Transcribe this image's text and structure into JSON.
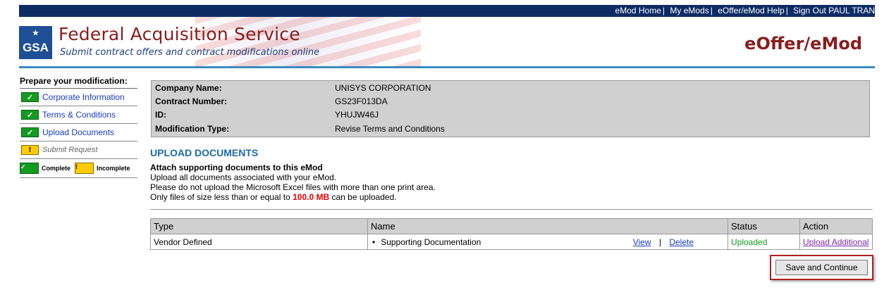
{
  "topnav": {
    "links": [
      "eMod Home",
      "My eMods",
      "eOffer/eMod Help",
      "Sign Out PAUL TRAN"
    ],
    "separator": "|"
  },
  "header": {
    "logo_text": "GSA",
    "logo_star": "★",
    "title": "Federal Acquisition Service",
    "subtitle": "Submit contract offers and contract modifications online",
    "app_title": "eOffer/eMod"
  },
  "sidebar": {
    "heading": "Prepare your modification:",
    "items": [
      {
        "label": "Corporate Information",
        "state": "complete"
      },
      {
        "label": "Terms & Conditions",
        "state": "complete"
      },
      {
        "label": "Upload Documents",
        "state": "complete"
      },
      {
        "label": "Submit Request",
        "state": "incomplete"
      }
    ],
    "legend": {
      "complete": "Complete",
      "incomplete": "Incomplete"
    },
    "check_icon": "✓",
    "warn_icon": "!"
  },
  "company": {
    "rows": [
      {
        "label": "Company Name:",
        "value": "UNISYS CORPORATION"
      },
      {
        "label": "Contract Number:",
        "value": "GS23F013DA"
      },
      {
        "label": "ID:",
        "value": "YHUJW46J"
      },
      {
        "label": "Modification Type:",
        "value": "Revise Terms and Conditions"
      }
    ]
  },
  "upload": {
    "section_title": "UPLOAD DOCUMENTS",
    "heading": "Attach supporting documents to this eMod",
    "line1": "Upload all documents associated with your eMod.",
    "line2": "Please do not upload the Microsoft Excel files with more than one print area.",
    "line3_pre": "Only files of size less than or equal to",
    "line3_size": "100.0 MB",
    "line3_post": "can be uploaded."
  },
  "table": {
    "headers": [
      "Type",
      "Name",
      "Status",
      "Action"
    ],
    "rows": [
      {
        "type": "Vendor Defined",
        "bullet": "•",
        "name": "Supporting Documentation",
        "view": "View",
        "sep": "|",
        "delete": "Delete",
        "status": "Uploaded",
        "action": "Upload Additional"
      }
    ]
  },
  "buttons": {
    "save_continue": "Save and Continue"
  },
  "colors": {
    "nav_bg": "#0d2c66",
    "title_red": "#8a1d1d",
    "accent_blue": "#1d6aab",
    "complete_green": "#139b1f",
    "incomplete_yellow": "#ffcc00",
    "highlight_red": "#b41f1f"
  }
}
